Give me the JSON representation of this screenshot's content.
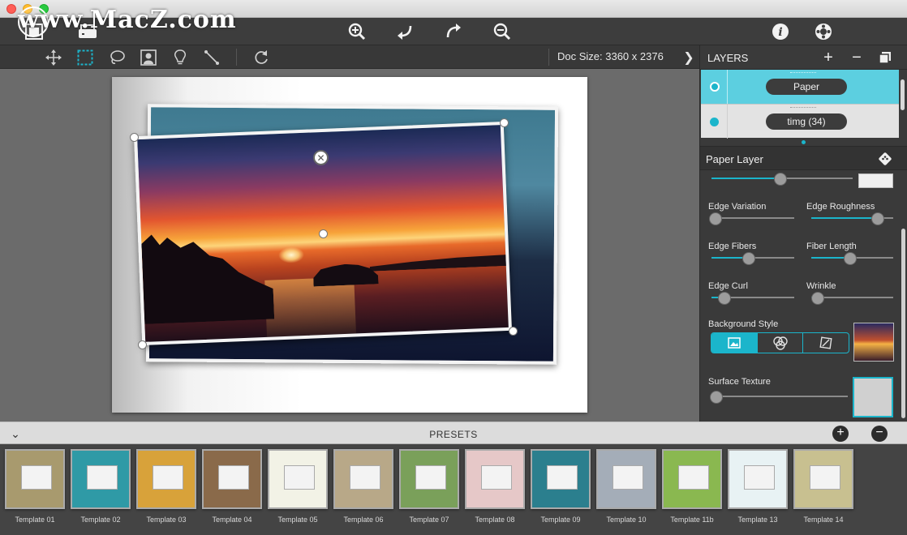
{
  "watermark": "www.MacZ.com",
  "toolbar": {
    "icons": [
      "frame-icon",
      "scanner-icon",
      "zoom-in-icon",
      "undo-icon",
      "redo-icon",
      "zoom-out-icon",
      "info-icon",
      "settings-icon"
    ]
  },
  "toolrow": {
    "doc_size": "Doc Size: 3360 x 2376"
  },
  "layers": {
    "title": "LAYERS",
    "items": [
      {
        "name": "Paper"
      },
      {
        "name": "timg (34)"
      }
    ]
  },
  "paper_layer": {
    "title": "Paper Layer",
    "top_slider": {
      "value": 0.49
    },
    "controls": [
      {
        "label": "Edge Variation",
        "value": 0.05
      },
      {
        "label": "Edge Roughness",
        "value": 0.81
      },
      {
        "label": "Edge Fibers",
        "value": 0.45
      },
      {
        "label": "Fiber Length",
        "value": 0.48
      },
      {
        "label": "Edge Curl",
        "value": 0.16
      },
      {
        "label": "Wrinkle",
        "value": 0.08
      }
    ],
    "background_style_label": "Background Style",
    "surface_texture_label": "Surface Texture",
    "surface_texture_value": 0.0
  },
  "presets": {
    "title": "PRESETS",
    "templates": [
      {
        "label": "Template 01",
        "color": "#a89a6e"
      },
      {
        "label": "Template 02",
        "color": "#2f9aa6"
      },
      {
        "label": "Template 03",
        "color": "#d8a23a"
      },
      {
        "label": "Template 04",
        "color": "#8a6a4a"
      },
      {
        "label": "Template 05",
        "color": "#f2f2e6"
      },
      {
        "label": "Template 06",
        "color": "#b8a888"
      },
      {
        "label": "Template 07",
        "color": "#7aa05a"
      },
      {
        "label": "Template 08",
        "color": "#e6c8c8"
      },
      {
        "label": "Template 09",
        "color": "#2b7f8e"
      },
      {
        "label": "Template 10",
        "color": "#a4adb8"
      },
      {
        "label": "Template 11b",
        "color": "#8ab850"
      },
      {
        "label": "Template 13",
        "color": "#e8f2f4"
      },
      {
        "label": "Template 14",
        "color": "#c8c090"
      }
    ]
  }
}
